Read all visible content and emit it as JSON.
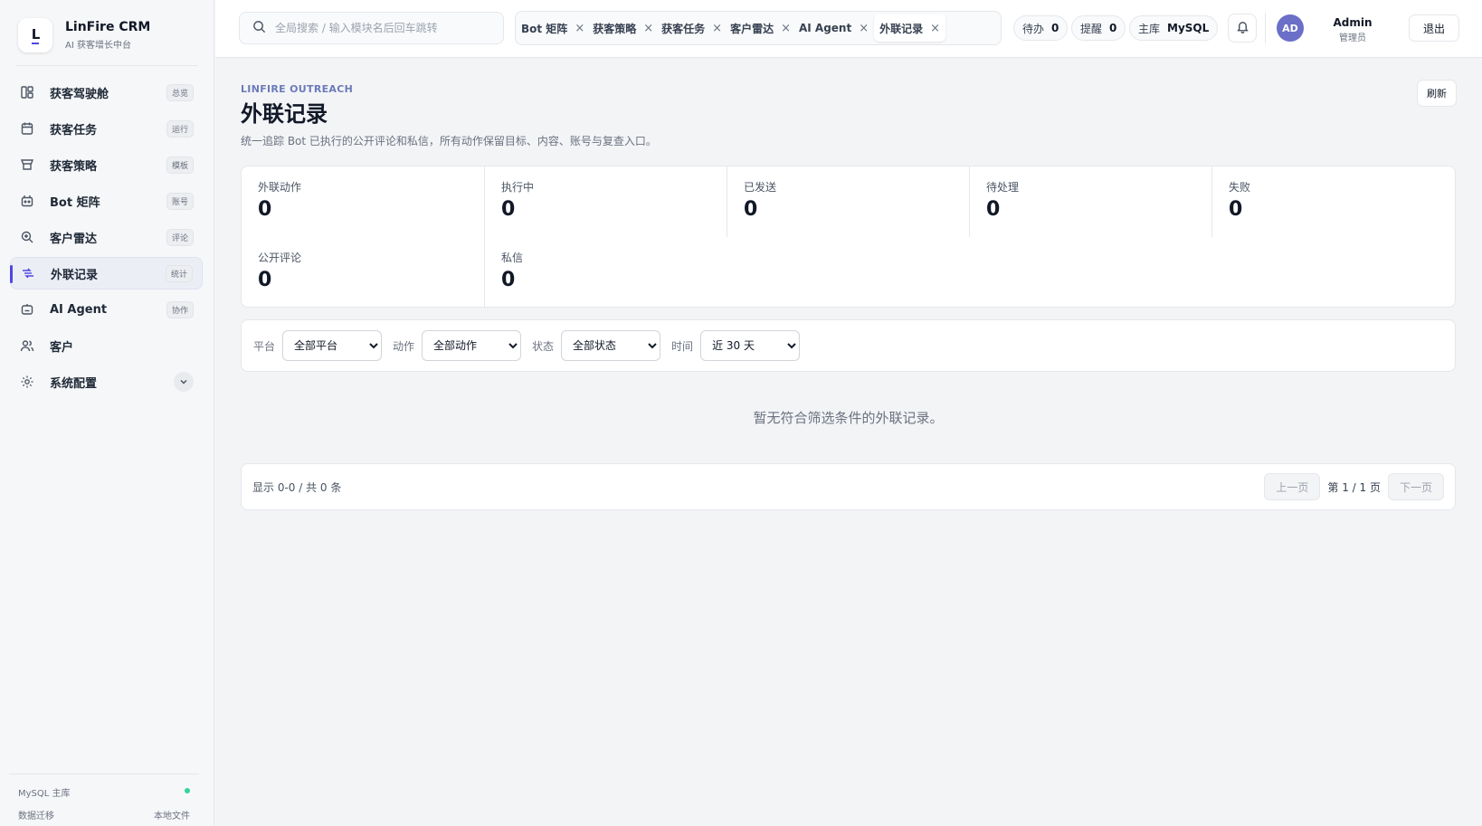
{
  "brand": {
    "logo_text": "L",
    "name": "LinFire CRM",
    "subtitle": "AI 获客增长中台"
  },
  "sidebar": {
    "items": [
      {
        "label": "获客驾驶舱",
        "badge": "总览",
        "icon": "dashboard-icon"
      },
      {
        "label": "获客任务",
        "badge": "运行",
        "icon": "calendar-icon"
      },
      {
        "label": "获客策略",
        "badge": "模板",
        "icon": "store-icon"
      },
      {
        "label": "Bot 矩阵",
        "badge": "账号",
        "icon": "robot-icon"
      },
      {
        "label": "客户雷达",
        "badge": "评论",
        "icon": "radar-icon"
      },
      {
        "label": "外联记录",
        "badge": "统计",
        "icon": "outreach-icon",
        "active": true
      },
      {
        "label": "AI Agent",
        "badge": "协作",
        "icon": "agent-icon"
      },
      {
        "label": "客户",
        "icon": "users-icon"
      },
      {
        "label": "系统配置",
        "icon": "gear-icon"
      }
    ],
    "footer": {
      "db_label": "MySQL 主库",
      "migrate_label": "数据迁移",
      "local_label": "本地文件",
      "status_color": "#34d399"
    }
  },
  "topbar": {
    "search_placeholder": "全局搜索 / 输入模块名后回车跳转",
    "tabs": [
      {
        "label": "Bot 矩阵"
      },
      {
        "label": "获客策略"
      },
      {
        "label": "获客任务"
      },
      {
        "label": "客户雷达"
      },
      {
        "label": "AI Agent"
      },
      {
        "label": "外联记录",
        "active": true
      }
    ],
    "tab_close": "×",
    "todo_label": "待办",
    "todo_count": "0",
    "remind_label": "提醒",
    "remind_count": "0",
    "db_label": "主库",
    "db_value": "MySQL",
    "avatar_initials": "AD",
    "user_name": "Admin",
    "user_role": "管理员",
    "logout_label": "退出"
  },
  "main": {
    "eyebrow": "LINFIRE OUTREACH",
    "title": "外联记录",
    "description": "统一追踪 Bot 已执行的公开评论和私信，所有动作保留目标、内容、账号与复查入口。",
    "refresh_label": "刷新",
    "stats": [
      {
        "label": "外联动作",
        "value": "0"
      },
      {
        "label": "执行中",
        "value": "0"
      },
      {
        "label": "已发送",
        "value": "0"
      },
      {
        "label": "待处理",
        "value": "0"
      },
      {
        "label": "失败",
        "value": "0"
      },
      {
        "label": "公开评论",
        "value": "0"
      },
      {
        "label": "私信",
        "value": "0"
      }
    ],
    "filters": {
      "platform_label": "平台",
      "platform_value": "全部平台",
      "action_label": "动作",
      "action_value": "全部动作",
      "status_label": "状态",
      "status_value": "全部状态",
      "time_label": "时间",
      "time_value": "近 30 天"
    },
    "empty_text": "暂无符合筛选条件的外联记录。",
    "pager": {
      "info": "显示 0-0 / 共 0 条",
      "prev_label": "上一页",
      "page_text": "第 1 / 1 页",
      "next_label": "下一页"
    }
  },
  "colors": {
    "accent": "#4f46e5",
    "avatar": "#6b6fc7",
    "eyebrow": "#6b7bb8"
  }
}
